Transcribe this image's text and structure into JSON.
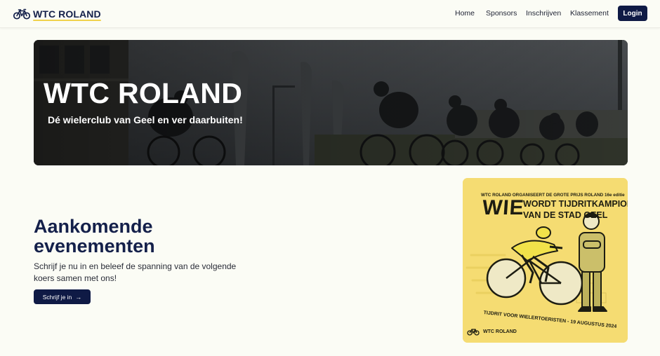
{
  "brand": {
    "name": "WTC ROLAND",
    "icon": "bicycle-icon"
  },
  "nav": {
    "items": [
      {
        "label": "Home"
      },
      {
        "label": "Sponsors"
      },
      {
        "label": "Inschrijven"
      },
      {
        "label": "Klassement"
      }
    ],
    "login_label": "Login"
  },
  "hero": {
    "title": "WTC ROLAND",
    "subtitle": "Dé wielerclub van Geel en ver daarbuiten!"
  },
  "events": {
    "title": "Aankomende evenementen",
    "description": "Schrijf je nu in en beleef de spanning van de volgende koers samen met ons!",
    "cta_label": "Schrijf je in",
    "cta_icon": "arrow-right-icon"
  },
  "poster": {
    "top_line": "WTC ROLAND ORGANISEERT DE GROTE PRIJS ROLAND 16e editie",
    "wie": "WIE",
    "headline_line1": "WORDT TIJDRITKAMPIOEN",
    "headline_line2": "VAN DE STAD GEEL",
    "bottom_line": "TIJDRIT VOOR WIELERTOERISTEN - 19 AUGUSTUS 2024",
    "brand": "WTC ROLAND"
  },
  "colors": {
    "navy": "#0f1a45",
    "brand_underline": "#f0d24d",
    "poster_yellow": "#f5dc72",
    "page_bg": "#fbfcf5"
  }
}
